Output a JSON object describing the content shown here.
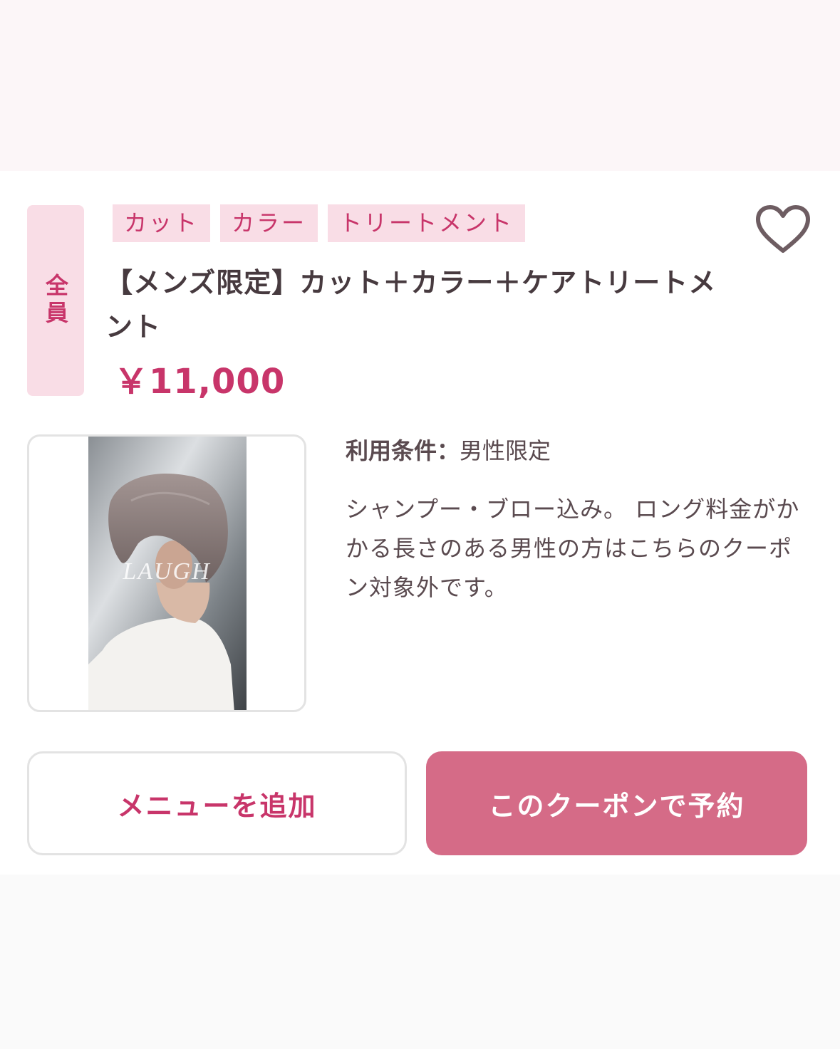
{
  "coupon": {
    "target_label": "全員",
    "tags": [
      "カット",
      "カラー",
      "トリートメント"
    ],
    "title": "【メンズ限定】カット＋カラー＋ケアトリートメント",
    "price": "￥11,000",
    "favorite_icon": "heart-outline-icon",
    "image_watermark": "LAUGH",
    "conditions_label": "利用条件：",
    "conditions_value": "男性限定",
    "description": "シャンプー・ブロー込み。 ロング料金がかかる長さのある男性の方はこちらのクーポン対象外です。"
  },
  "actions": {
    "add_menu_label": "メニューを追加",
    "reserve_label": "このクーポンで予約"
  },
  "colors": {
    "accent": "#c8356a",
    "tag_bg": "#f9dde6",
    "reserve_button": "#d56b87"
  }
}
